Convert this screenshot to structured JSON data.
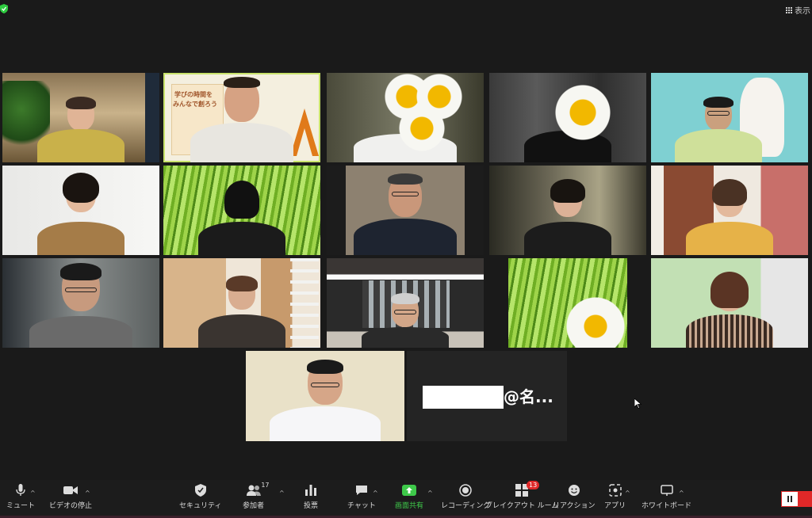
{
  "topbar": {
    "view_label": "表示"
  },
  "active_speaker_slide": {
    "title_line1": "学びの時間を",
    "title_line2": "みんなで創ろう"
  },
  "name_tile": {
    "name_suffix": "@名..."
  },
  "toolbar": {
    "mute_label": "ミュート",
    "video_label": "ビデオの停止",
    "security_label": "セキュリティ",
    "participants_label": "参加者",
    "participants_count": "17",
    "polls_label": "投票",
    "chat_label": "チャット",
    "share_label": "画面共有",
    "recording_label": "レコーディング",
    "breakout_label": "ブレイクアウト ルーム",
    "breakout_badge": "13",
    "reactions_label": "リアクション",
    "apps_label": "アプリ",
    "whiteboard_label": "ホワイトボード"
  },
  "colors": {
    "background": "#1a1a1a",
    "active_speaker_border": "#c8e26b",
    "share_green": "#3ec94a",
    "badge_red": "#e02828",
    "security_green": "#2ecc40"
  },
  "icons": [
    "security-shield-icon",
    "grid-view-icon",
    "microphone-icon",
    "video-camera-icon",
    "shield-icon",
    "participants-icon",
    "poll-icon",
    "chat-icon",
    "share-screen-icon",
    "record-icon",
    "breakout-icon",
    "reaction-icon",
    "apps-icon",
    "whiteboard-icon",
    "pause-icon",
    "stop-icon",
    "mouse-cursor-icon"
  ]
}
